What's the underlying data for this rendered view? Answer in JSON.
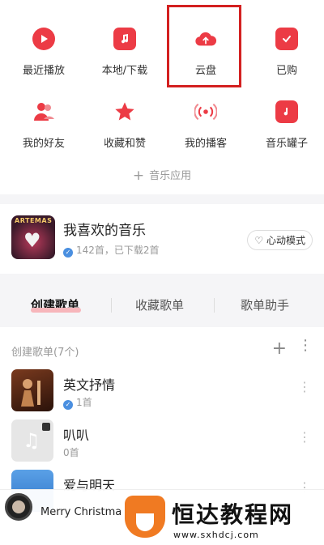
{
  "grid": {
    "items": [
      {
        "label": "最近播放",
        "icon": "play-icon"
      },
      {
        "label": "本地/下载",
        "icon": "music-file-icon"
      },
      {
        "label": "云盘",
        "icon": "cloud-upload-icon"
      },
      {
        "label": "已购",
        "icon": "shopping-bag-icon"
      },
      {
        "label": "我的好友",
        "icon": "friends-icon"
      },
      {
        "label": "收藏和赞",
        "icon": "star-icon"
      },
      {
        "label": "我的播客",
        "icon": "broadcast-icon"
      },
      {
        "label": "音乐罐子",
        "icon": "music-jar-icon"
      }
    ],
    "add_apps": "音乐应用",
    "accent": "#ec3b45",
    "highlight_color": "#d32020"
  },
  "favorite": {
    "cover_caption": "ARTEMAS",
    "title": "我喜欢的音乐",
    "subtitle": "142首，已下载2首",
    "mode_button": "心动模式"
  },
  "tabs": [
    {
      "label": "创建歌单",
      "active": true
    },
    {
      "label": "收藏歌单",
      "active": false
    },
    {
      "label": "歌单助手",
      "active": false
    }
  ],
  "playlists": {
    "header": "创建歌单(7个)",
    "items": [
      {
        "name": "英文抒情",
        "count": "1首",
        "verified": true
      },
      {
        "name": "叭叭",
        "count": "0首",
        "verified": false
      },
      {
        "name": "爱与明天",
        "count": "",
        "verified": false
      }
    ]
  },
  "player": {
    "title": "Merry Christma"
  },
  "watermark": {
    "text": "恒达教程网",
    "url": "www.sxhdcj.com"
  }
}
